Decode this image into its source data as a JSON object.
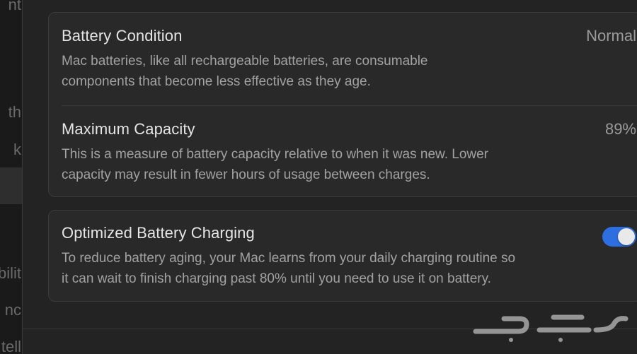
{
  "sidebar": {
    "items": [
      {
        "label": "nt"
      },
      {
        "label": "th"
      },
      {
        "label": "k"
      },
      {
        "label": "bilit"
      },
      {
        "label": "nc"
      },
      {
        "label": "tell"
      }
    ]
  },
  "battery_condition": {
    "title": "Battery Condition",
    "value": "Normal",
    "description_line1": "Mac batteries, like all rechargeable batteries, are consumable",
    "description_line2": "components that become less effective as they age."
  },
  "maximum_capacity": {
    "title": "Maximum Capacity",
    "value": "89%",
    "description_line1": "This is a measure of battery capacity relative to when it was new. Lower",
    "description_line2": "capacity may result in fewer hours of usage between charges."
  },
  "optimized_charging": {
    "title": "Optimized Battery Charging",
    "enabled": true,
    "description_line1": "To reduce battery aging, your Mac learns from your daily charging routine so",
    "description_line2": "it can wait to finish charging past 80% until you need to use it on battery."
  },
  "watermark": {
    "text": "حراج"
  },
  "colors": {
    "toggle_on": "#2d6ee0",
    "background": "#242323",
    "group_background": "#2a2929"
  }
}
